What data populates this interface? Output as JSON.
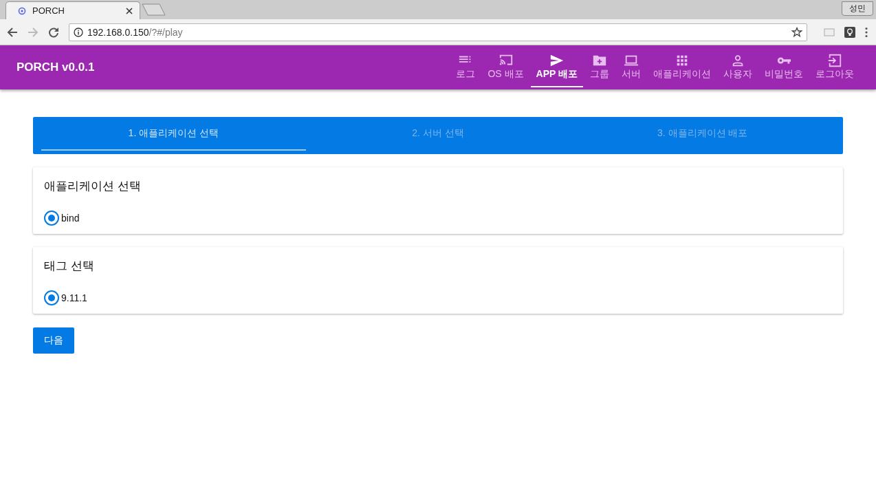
{
  "browser": {
    "tabs": [
      {
        "title": "PORCH",
        "selected": true
      }
    ],
    "profile": "성민",
    "url_host": "192.168.0.150",
    "url_path": "/?#/play"
  },
  "app_bar": {
    "title": "PORCH v0.0.1",
    "nav": [
      {
        "label": "로그",
        "kind": "list",
        "selected": false
      },
      {
        "label": "OS 배포",
        "kind": "cast",
        "selected": false
      },
      {
        "label": "APP 배포",
        "kind": "send",
        "selected": true
      },
      {
        "label": "그룹",
        "kind": "folder",
        "selected": false
      },
      {
        "label": "서버",
        "kind": "laptop",
        "selected": false
      },
      {
        "label": "애플리케이션",
        "kind": "grid",
        "selected": false
      },
      {
        "label": "사용자",
        "kind": "person",
        "selected": false
      },
      {
        "label": "비밀번호",
        "kind": "key",
        "selected": false
      },
      {
        "label": "로그아웃",
        "kind": "exit",
        "selected": false
      }
    ]
  },
  "stepper": [
    {
      "label": "1. 애플리케이션 선택",
      "selected": true
    },
    {
      "label": "2. 서버 선택",
      "selected": false
    },
    {
      "label": "3. 애플리케이션 배포",
      "selected": false
    }
  ],
  "cards": [
    {
      "title": "애플리케이션 선택",
      "options": [
        {
          "label": "bind",
          "selected": true
        }
      ]
    },
    {
      "title": "태그 선택",
      "options": [
        {
          "label": "9.11.1",
          "selected": true
        }
      ]
    }
  ],
  "next_button": "다음"
}
